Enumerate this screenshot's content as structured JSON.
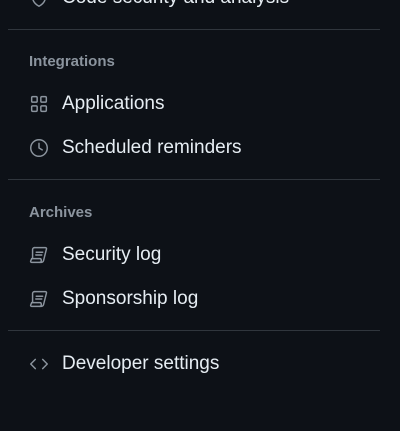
{
  "top_item": {
    "label": "Code security and analysis",
    "icon": "shield-icon"
  },
  "integrations": {
    "heading": "Integrations",
    "items": [
      {
        "label": "Applications",
        "icon": "apps-grid-icon"
      },
      {
        "label": "Scheduled reminders",
        "icon": "clock-icon"
      }
    ]
  },
  "archives": {
    "heading": "Archives",
    "items": [
      {
        "label": "Security log",
        "icon": "log-icon"
      },
      {
        "label": "Sponsorship log",
        "icon": "log-icon"
      }
    ]
  },
  "developer": {
    "label": "Developer settings",
    "icon": "code-icon"
  }
}
